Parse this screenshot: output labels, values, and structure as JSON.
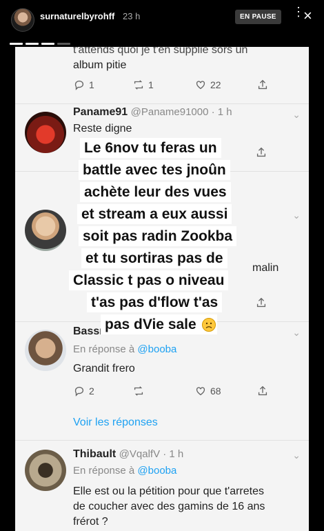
{
  "story": {
    "username": "surnaturelbyrohff",
    "time": "23 h",
    "paused_label": "EN PAUSE"
  },
  "tweets": {
    "partial_top": {
      "text_cut": "t'attends quoi je t'en supplie sors un",
      "text": "album pitie",
      "replies": "1",
      "retweets": "1",
      "likes": "22"
    },
    "paname": {
      "name": "Paname91",
      "handle": "@Paname91000 · 1 h",
      "text": "Reste digne"
    },
    "second": {
      "text_right": "malin"
    },
    "bass": {
      "name": "Bassrour",
      "reply_to_prefix": "En réponse à ",
      "reply_to": "@booba",
      "text": "Grandit frero",
      "replies": "2",
      "retweets": "",
      "likes": "68",
      "view_replies": "Voir les réponses"
    },
    "thibault": {
      "name": "Thibault",
      "handle": "@VqalfV · 1 h",
      "reply_to_prefix": "En réponse à ",
      "reply_to": "@booba",
      "text_l1": "Elle est ou la pétition pour que t'arretes",
      "text_l2": "de coucher avec des gamins de 16 ans",
      "text_l3": "frérot ?"
    }
  },
  "overlay": {
    "lines": [
      "Le 6nov tu feras un",
      "battle avec tes jnoûn",
      "achète leur des vues",
      "et stream a eux aussi",
      "soit pas radin Zookba",
      "et tu sortiras pas de",
      "Classic t pas o niveau",
      "t'as pas d'flow t'as",
      "pas dVie sale"
    ]
  }
}
